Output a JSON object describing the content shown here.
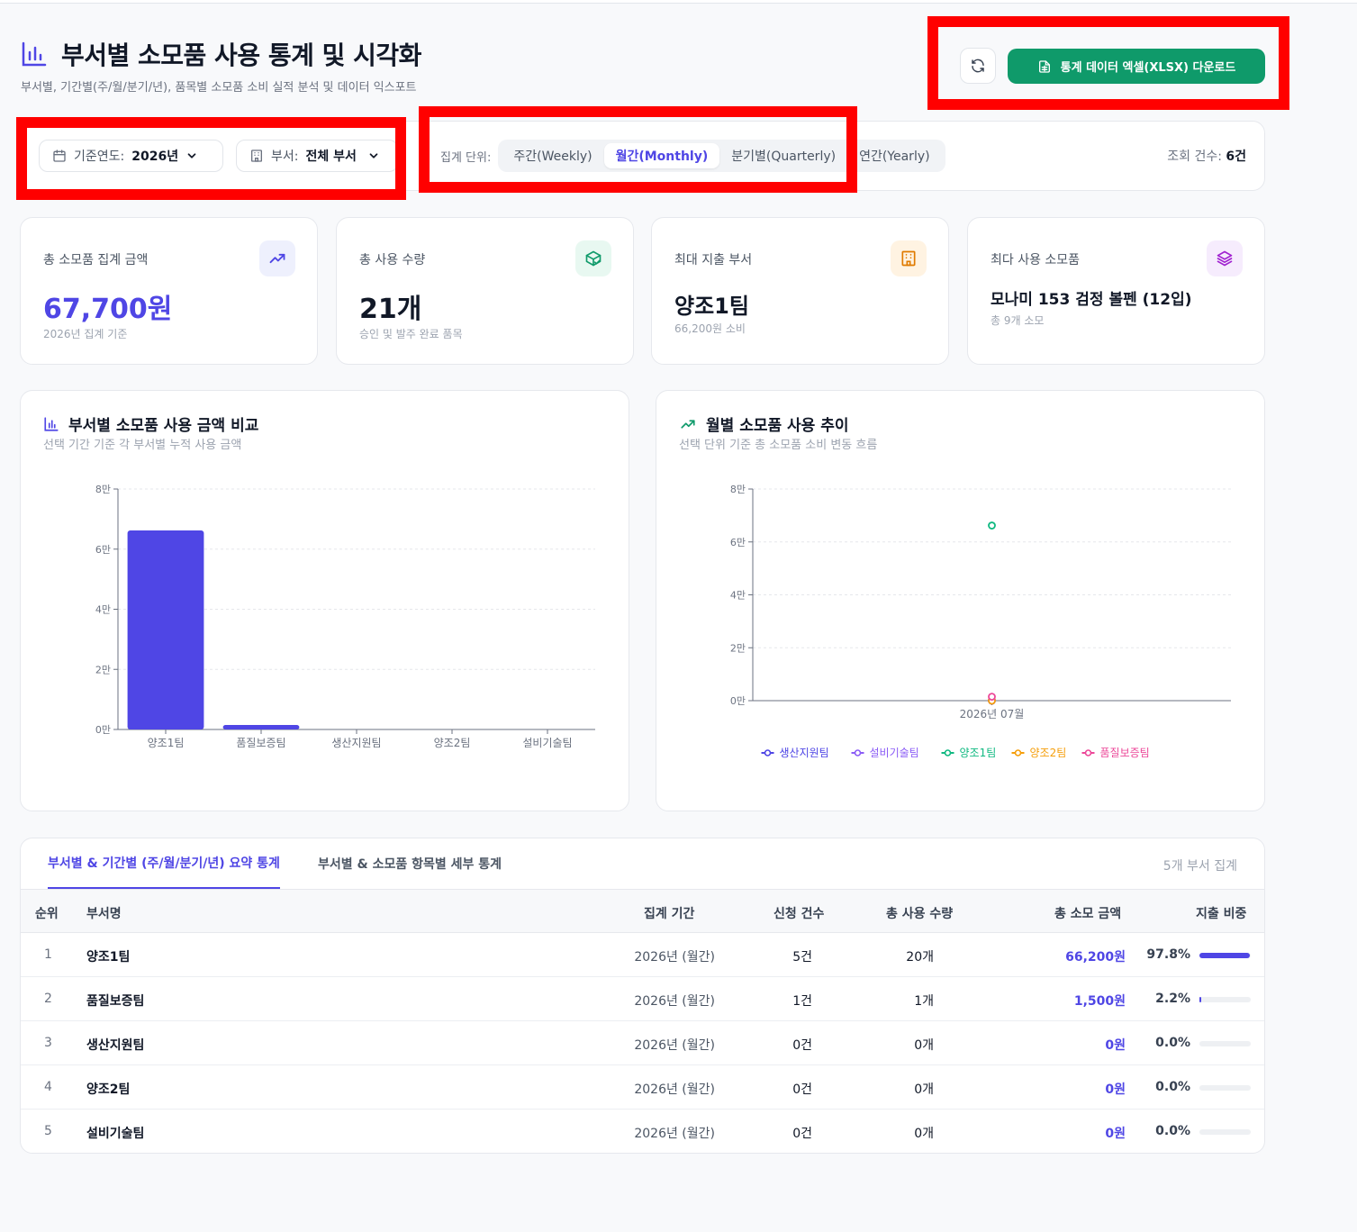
{
  "header": {
    "title": "부서별 소모품 사용 통계 및 시각화",
    "subtitle": "부서별, 기간별(주/월/분기/년), 품목별 소모품 소비 실적 분석 및 데이터 익스포트",
    "download_label": "통계 데이터 엑셀(XLSX) 다운로드"
  },
  "filters": {
    "year_label": "기준연도:",
    "year_value": "2026년",
    "dept_label": "부서:",
    "dept_value": "전체 부서",
    "unit_label": "집계 단위:",
    "units": [
      "주간(Weekly)",
      "월간(Monthly)",
      "분기별(Quarterly)",
      "연간(Yearly)"
    ],
    "active_unit": "월간(Monthly)",
    "count_label": "조회 건수:",
    "count_value": "6건"
  },
  "cards": [
    {
      "label": "총 소모품 집계 금액",
      "value": "67,700원",
      "sub": "2026년 집계 기준"
    },
    {
      "label": "총 사용 수량",
      "value": "21개",
      "sub": "승인 및 발주 완료 품목"
    },
    {
      "label": "최대 지출 부서",
      "value": "양조1팀",
      "sub": "66,200원 소비"
    },
    {
      "label": "최다 사용 소모품",
      "value": "모나미 153 검정 볼펜 (12입)",
      "sub": "총 9개 소모"
    }
  ],
  "colors": {
    "accent": "#4f46e5",
    "green": "#0f9a6a",
    "series": [
      "#4f46e5",
      "#8b5cf6",
      "#10b981",
      "#f59e0b",
      "#ec4899"
    ]
  },
  "chart_data": [
    {
      "type": "bar",
      "title": "부서별 소모품 사용 금액 비교",
      "subtitle": "선택 기간 기준 각 부서별 누적 사용 금액",
      "categories": [
        "양조1팀",
        "품질보증팀",
        "생산지원팀",
        "양조2팀",
        "설비기술팀"
      ],
      "values": [
        66200,
        1500,
        0,
        0,
        0
      ],
      "ylim": [
        0,
        80000
      ],
      "yticks": [
        0,
        20000,
        40000,
        60000,
        80000
      ],
      "ytick_labels": [
        "0만",
        "2만",
        "4만",
        "6만",
        "8만"
      ],
      "grid": true
    },
    {
      "type": "line",
      "title": "월별 소모품 사용 추이",
      "subtitle": "선택 단위 기준 총 소모품 소비 변동 흐름",
      "x": [
        "2026년 07월"
      ],
      "series": [
        {
          "name": "생산지원팀",
          "values": [
            0
          ]
        },
        {
          "name": "설비기술팀",
          "values": [
            0
          ]
        },
        {
          "name": "양조1팀",
          "values": [
            66200
          ]
        },
        {
          "name": "양조2팀",
          "values": [
            0
          ]
        },
        {
          "name": "품질보증팀",
          "values": [
            1500
          ]
        }
      ],
      "ylim": [
        0,
        80000
      ],
      "yticks": [
        0,
        20000,
        40000,
        60000,
        80000
      ],
      "ytick_labels": [
        "0만",
        "2만",
        "4만",
        "6만",
        "8만"
      ],
      "grid": true,
      "legend": "bottom"
    }
  ],
  "table": {
    "tabs": [
      "부서별 & 기간별 (주/월/분기/년) 요약 통계",
      "부서별 & 소모품 항목별 세부 통계"
    ],
    "aggregate_label": "5개 부서 집계",
    "headers": [
      "순위",
      "부서명",
      "집계 기간",
      "신청 건수",
      "총 사용 수량",
      "총 소모 금액",
      "지출 비중"
    ],
    "rows": [
      {
        "rank": "1",
        "name": "양조1팀",
        "period": "2026년 (월간)",
        "requests": "5건",
        "qty": "20개",
        "amount": "66,200원",
        "pct": "97.8%",
        "share": 0.978
      },
      {
        "rank": "2",
        "name": "품질보증팀",
        "period": "2026년 (월간)",
        "requests": "1건",
        "qty": "1개",
        "amount": "1,500원",
        "pct": "2.2%",
        "share": 0.022
      },
      {
        "rank": "3",
        "name": "생산지원팀",
        "period": "2026년 (월간)",
        "requests": "0건",
        "qty": "0개",
        "amount": "0원",
        "pct": "0.0%",
        "share": 0
      },
      {
        "rank": "4",
        "name": "양조2팀",
        "period": "2026년 (월간)",
        "requests": "0건",
        "qty": "0개",
        "amount": "0원",
        "pct": "0.0%",
        "share": 0
      },
      {
        "rank": "5",
        "name": "설비기술팀",
        "period": "2026년 (월간)",
        "requests": "0건",
        "qty": "0개",
        "amount": "0원",
        "pct": "0.0%",
        "share": 0
      }
    ]
  }
}
